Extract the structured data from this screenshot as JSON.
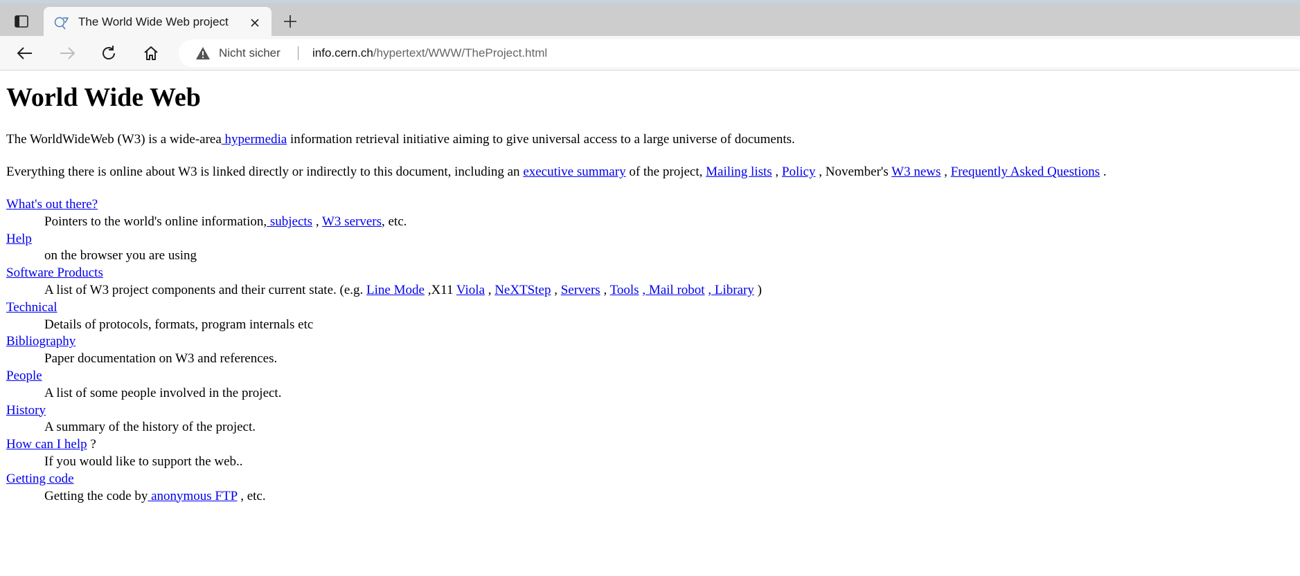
{
  "browser": {
    "tab_title": "The World Wide Web project",
    "not_secure_label": "Nicht sicher",
    "url_host": "info.cern.ch",
    "url_path": "/hypertext/WWW/TheProject.html"
  },
  "page": {
    "heading": "World Wide Web",
    "intro": {
      "before": "The WorldWideWeb (W3) is a wide-area",
      "link": " hypermedia",
      "after": " information retrieval initiative aiming to give universal access to a large universe of documents."
    },
    "summary": {
      "before": "Everything there is online about W3 is linked directly or indirectly to this document, including an ",
      "link_exec": "executive summary",
      "t1": " of the project, ",
      "link_mailing": "Mailing lists",
      "t2": " , ",
      "link_policy": "Policy",
      "t3": " , November's ",
      "link_news": "W3 news",
      "t4": " , ",
      "link_faq": "Frequently Asked Questions",
      "t5": " ."
    },
    "items": [
      {
        "title": "What's out there?",
        "desc_before": "Pointers to the world's online information,",
        "link_subjects": " subjects",
        "sep1": " , ",
        "link_servers": "W3 servers",
        "desc_after": ", etc."
      },
      {
        "title": "Help",
        "desc": "on the browser you are using"
      },
      {
        "title": "Software Products",
        "desc_before": "A list of W3 project components and their current state. (e.g. ",
        "link_linemode": "Line Mode",
        "t1": " ,X11 ",
        "link_viola": "Viola",
        "t2": " , ",
        "link_nextstep": "NeXTStep",
        "t3": " , ",
        "link_servers": "Servers",
        "t4": " , ",
        "link_tools": "Tools",
        "t5": " ",
        "link_mailrobot": ", Mail robot",
        "t6": " ",
        "link_library": ", Library",
        "t7": " )"
      },
      {
        "title": "Technical",
        "desc": "Details of protocols, formats, program internals etc"
      },
      {
        "title": "Bibliography",
        "desc": "Paper documentation on W3 and references."
      },
      {
        "title": "People",
        "desc": "A list of some people involved in the project."
      },
      {
        "title": "History",
        "desc": "A summary of the history of the project."
      },
      {
        "title": "How can I help",
        "title_suffix": " ?",
        "desc": "If you would like to support the web.."
      },
      {
        "title": "Getting code",
        "desc_before": "Getting the code by",
        "link_ftp": " anonymous FTP",
        "desc_after": " , etc."
      }
    ]
  }
}
